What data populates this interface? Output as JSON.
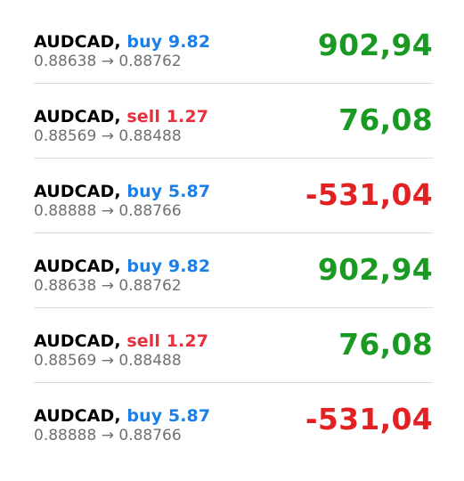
{
  "trades": [
    {
      "symbol": "AUDCAD",
      "sep": ", ",
      "side": "buy",
      "volume": "9.82",
      "open": "0.88638",
      "arrow": "→",
      "close": "0.88762",
      "profit": "902,94",
      "sign": "pos"
    },
    {
      "symbol": "AUDCAD",
      "sep": ", ",
      "side": "sell",
      "volume": "1.27",
      "open": "0.88569",
      "arrow": "→",
      "close": "0.88488",
      "profit": "76,08",
      "sign": "pos"
    },
    {
      "symbol": "AUDCAD",
      "sep": ", ",
      "side": "buy",
      "volume": "5.87",
      "open": "0.88888",
      "arrow": "→",
      "close": "0.88766",
      "profit": "-531,04",
      "sign": "neg"
    },
    {
      "symbol": "AUDCAD",
      "sep": ", ",
      "side": "buy",
      "volume": "9.82",
      "open": "0.88638",
      "arrow": "→",
      "close": "0.88762",
      "profit": "902,94",
      "sign": "pos"
    },
    {
      "symbol": "AUDCAD",
      "sep": ", ",
      "side": "sell",
      "volume": "1.27",
      "open": "0.88569",
      "arrow": "→",
      "close": "0.88488",
      "profit": "76,08",
      "sign": "pos"
    },
    {
      "symbol": "AUDCAD",
      "sep": ", ",
      "side": "buy",
      "volume": "5.87",
      "open": "0.88888",
      "arrow": "→",
      "close": "0.88766",
      "profit": "-531,04",
      "sign": "neg"
    }
  ],
  "colors": {
    "buy": "#1a7fe8",
    "sell": "#e8303d",
    "profit_positive": "#1a9a22",
    "profit_negative": "#e22222",
    "secondary_text": "#707070",
    "divider": "#d9d9d9"
  }
}
